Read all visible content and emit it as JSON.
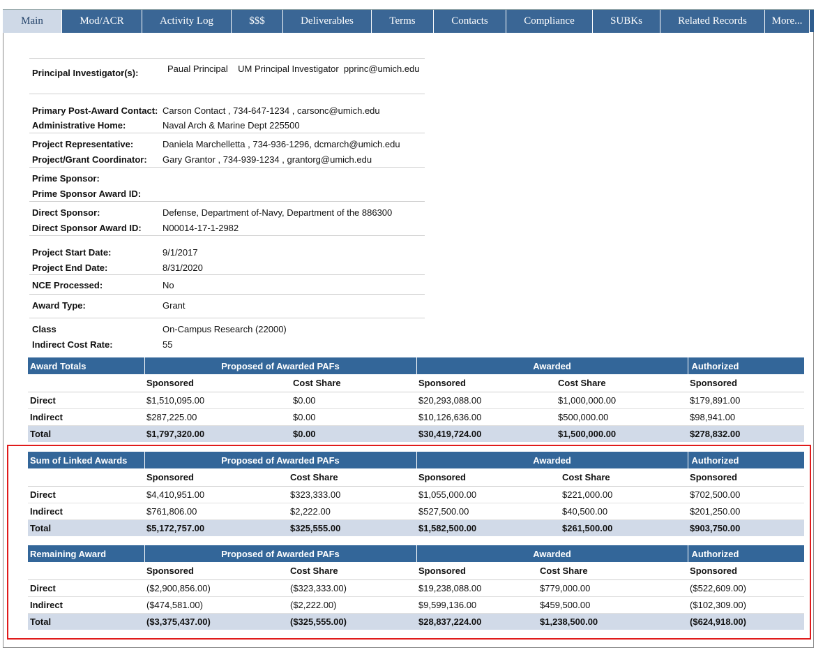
{
  "tabs": [
    "Main",
    "Mod/ACR",
    "Activity Log",
    "$$$",
    "Deliverables",
    "Terms",
    "Contacts",
    "Compliance",
    "SUBKs",
    "Related Records",
    "More..."
  ],
  "info": {
    "pi_label": "Principal Investigator(s):",
    "pi_name": "Paual Principal",
    "pi_role": "UM Principal Investigator",
    "pi_email": "pprinc@umich.edu",
    "ppac_label": "Primary Post-Award Contact:",
    "ppac_value": "Carson Contact , 734-647-1234 , carsonc@umich.edu",
    "home_label": "Administrative Home:",
    "home_value": "Naval Arch & Marine Dept   225500",
    "prep_label": "Project Representative:",
    "prep_value": "Daniela Marchelletta ,  734-936-1296,  dcmarch@umich.edu",
    "pgc_label": "Project/Grant Coordinator:",
    "pgc_value": "Gary Grantor , 734-939-1234 , grantorg@umich.edu",
    "prime_label": "Prime Sponsor:",
    "prime_id_label": "Prime Sponsor Award ID:",
    "direct_label": "Direct Sponsor:",
    "direct_value": "Defense, Department of-Navy, Department of the   886300",
    "direct_id_label": "Direct Sponsor Award ID:",
    "direct_id_value": "N00014-17-1-2982",
    "start_label": "Project Start Date:",
    "start_value": "9/1/2017",
    "end_label": "Project End Date:",
    "end_value": "8/31/2020",
    "nce_label": "NCE Processed:",
    "nce_value": "No",
    "type_label": "Award Type:",
    "type_value": "Grant",
    "class_label": "Class",
    "class_value": "On-Campus Research (22000)",
    "icr_label": "Indirect Cost Rate:",
    "icr_value": "55"
  },
  "tables": {
    "award_totals": {
      "title": "Award Totals",
      "group1": "Proposed of Awarded PAFs",
      "group2": "Awarded",
      "group3": "Authorized",
      "sub1": "Sponsored",
      "sub2": "Cost Share",
      "sub3": "Sponsored",
      "sub4": "Cost Share",
      "sub5": "Sponsored",
      "rows": [
        [
          "Direct",
          "$1,510,095.00",
          "$0.00",
          "$20,293,088.00",
          "$1,000,000.00",
          "$179,891.00"
        ],
        [
          "Indirect",
          "$287,225.00",
          "$0.00",
          "$10,126,636.00",
          "$500,000.00",
          "$98,941.00"
        ],
        [
          "Total",
          "$1,797,320.00",
          "$0.00",
          "$30,419,724.00",
          "$1,500,000.00",
          "$278,832.00"
        ]
      ]
    },
    "linked": {
      "title": "Sum of Linked Awards",
      "group1": "Proposed of Awarded PAFs",
      "group2": "Awarded",
      "group3": "Authorized",
      "sub1": "Sponsored",
      "sub2": "Cost Share",
      "sub3": "Sponsored",
      "sub4": "Cost Share",
      "sub5": "Sponsored",
      "rows": [
        [
          "Direct",
          "$4,410,951.00",
          "$323,333.00",
          "$1,055,000.00",
          "$221,000.00",
          "$702,500.00"
        ],
        [
          "Indirect",
          "$761,806.00",
          "$2,222.00",
          "$527,500.00",
          "$40,500.00",
          "$201,250.00"
        ],
        [
          "Total",
          "$5,172,757.00",
          "$325,555.00",
          "$1,582,500.00",
          "$261,500.00",
          "$903,750.00"
        ]
      ]
    },
    "remaining": {
      "title": "Remaining Award",
      "group1": "Proposed of Awarded PAFs",
      "group2": "Awarded",
      "group3": "Authorized",
      "sub1": "Sponsored",
      "sub2": "Cost Share",
      "sub3": "Sponsored",
      "sub4": "Cost Share",
      "sub5": "Sponsored",
      "rows": [
        [
          "Direct",
          "($2,900,856.00)",
          "($323,333.00)",
          "$19,238,088.00",
          "$779,000.00",
          "($522,609.00)"
        ],
        [
          "Indirect",
          "($474,581.00)",
          "($2,222.00)",
          "$9,599,136.00",
          "$459,500.00",
          "($102,309.00)"
        ],
        [
          "Total",
          "($3,375,437.00)",
          "($325,555.00)",
          "$28,837,224.00",
          "$1,238,500.00",
          "($624,918.00)"
        ]
      ]
    }
  },
  "colors": {
    "header_blue": "#336699",
    "total_row": "#d1dae8",
    "highlight_red": "#e01b1b"
  }
}
